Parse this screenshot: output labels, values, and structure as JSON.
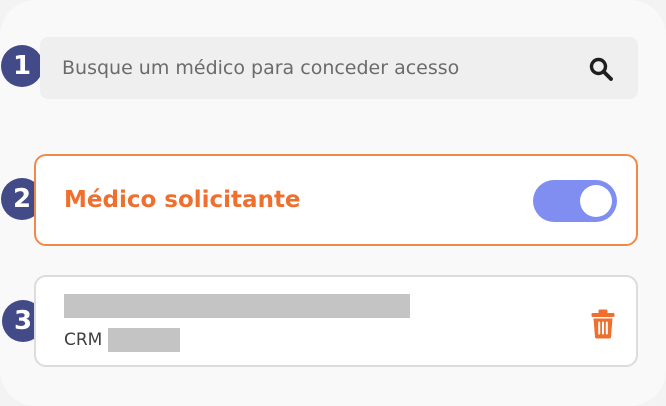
{
  "badges": [
    "1",
    "2",
    "3"
  ],
  "search": {
    "placeholder": "Busque um médico para conceder acesso",
    "icon": "search-icon"
  },
  "requesting_doctor": {
    "label": "Médico solicitante",
    "enabled": true,
    "accent_color": "#ef6f2e",
    "toggle_color": "#7f8ef0"
  },
  "doctor": {
    "name": "",
    "crm_prefix": "CRM",
    "crm_number": "",
    "delete_icon": "trash-icon"
  },
  "colors": {
    "badge": "#424a87",
    "card_border": "#dcdcdc",
    "highlight_border": "#f08a48"
  }
}
